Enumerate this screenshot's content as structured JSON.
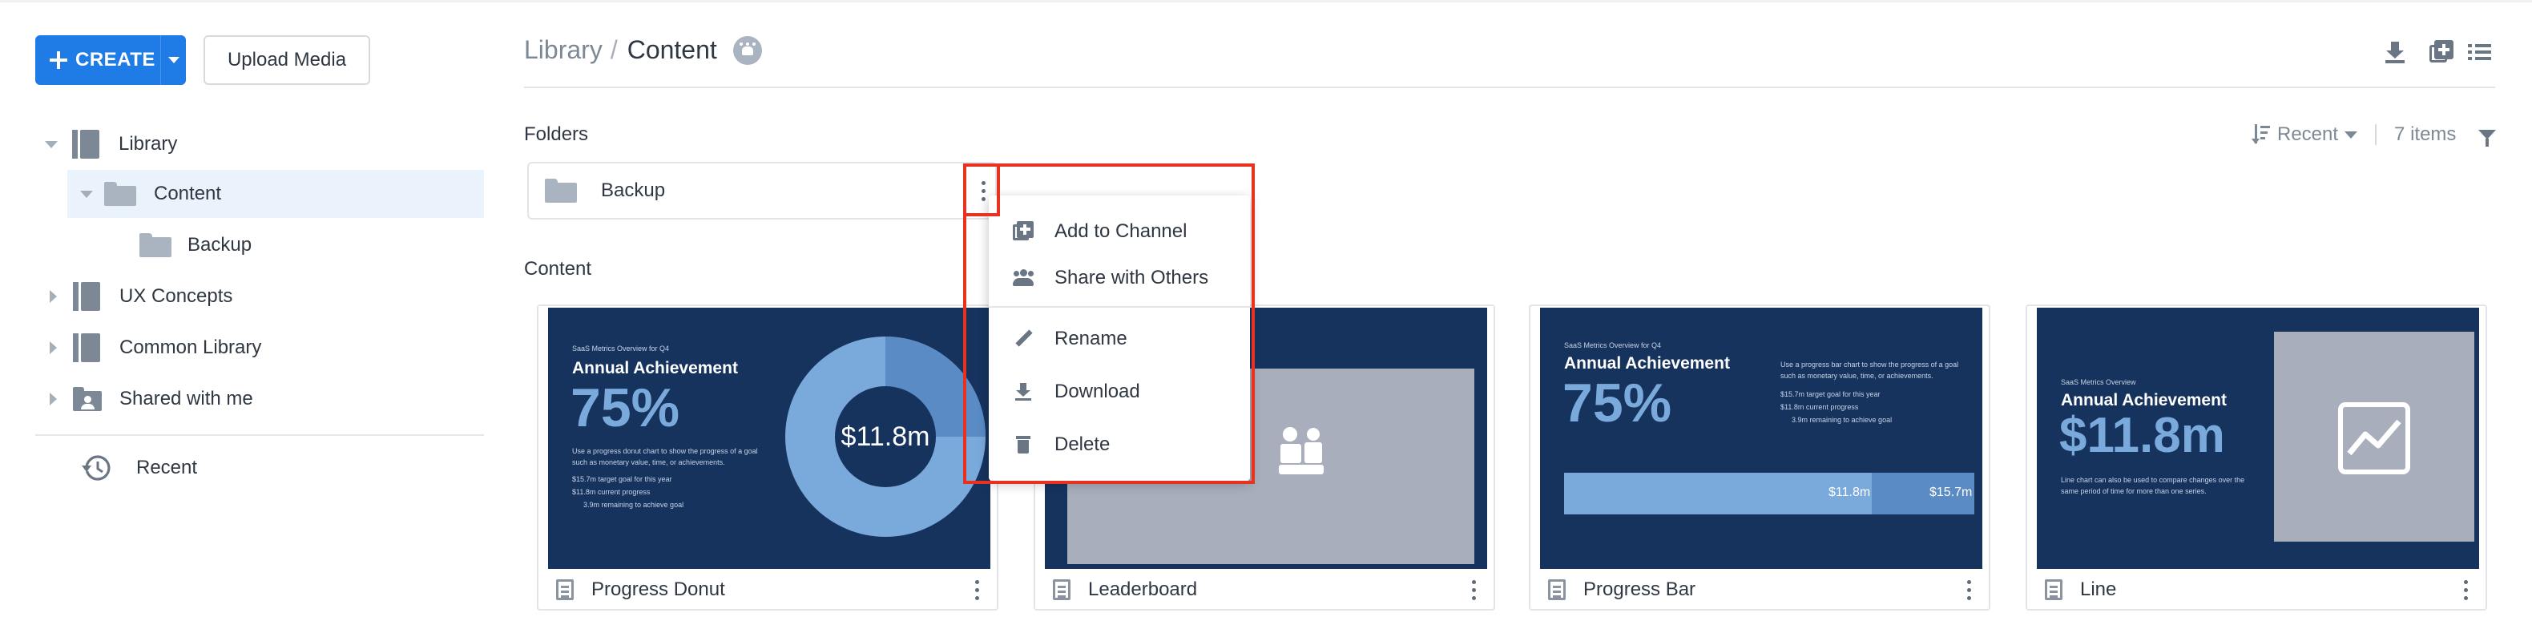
{
  "sidebar": {
    "create_label": "CREATE",
    "upload_label": "Upload Media",
    "tree": {
      "library": "Library",
      "content": "Content",
      "backup": "Backup",
      "ux_concepts": "UX Concepts",
      "common_library": "Common Library",
      "shared_with_me": "Shared with me"
    },
    "recent": "Recent"
  },
  "header": {
    "breadcrumb_root": "Library",
    "breadcrumb_sep": "/",
    "breadcrumb_current": "Content"
  },
  "folders": {
    "section_label": "Folders",
    "items": [
      {
        "name": "Backup"
      }
    ]
  },
  "toolbar": {
    "sort_label": "Recent",
    "item_count": "7 items"
  },
  "context_menu": {
    "items": [
      "Add to Channel",
      "Share with Others",
      "Rename",
      "Download",
      "Delete"
    ]
  },
  "content": {
    "section_label": "Content",
    "cards": [
      {
        "name": "Progress Donut",
        "thumb": {
          "eyebrow": "SaaS Metrics Overview for Q4",
          "title": "Annual Achievement",
          "big": "75%",
          "desc": "Use a progress donut chart to show the progress of a goal such as monetary value, time, or achievements.",
          "stats": [
            "$15.7m  target goal for this year",
            "$11.8m  current progress",
            "3.9m  remaining to achieve goal"
          ],
          "center_value": "$11.8m",
          "progress": 0.75
        }
      },
      {
        "name": "Leaderboard"
      },
      {
        "name": "Progress Bar",
        "thumb": {
          "eyebrow": "SaaS Metrics Overview for Q4",
          "title": "Annual Achievement",
          "big": "75%",
          "desc": "Use a progress bar chart to show the progress of a goal such as monetary value, time, or achievements.",
          "stats": [
            "$15.7m  target goal for this year",
            "$11.8m  current progress",
            "3.9m  remaining to achieve goal"
          ],
          "bar_current": "$11.8m",
          "bar_target": "$15.7m",
          "progress": 0.75
        }
      },
      {
        "name": "Line",
        "thumb": {
          "eyebrow": "SaaS Metrics Overview",
          "title": "Annual Achievement",
          "big": "$11.8m",
          "desc": "Line chart can also be used to compare changes over the same period of time for more than one series."
        }
      }
    ]
  },
  "colors": {
    "accent": "#1f7be6",
    "highlight": "#e8311f",
    "thumb_bg": "#16335e",
    "thumb_accent": "#7aa9db"
  }
}
